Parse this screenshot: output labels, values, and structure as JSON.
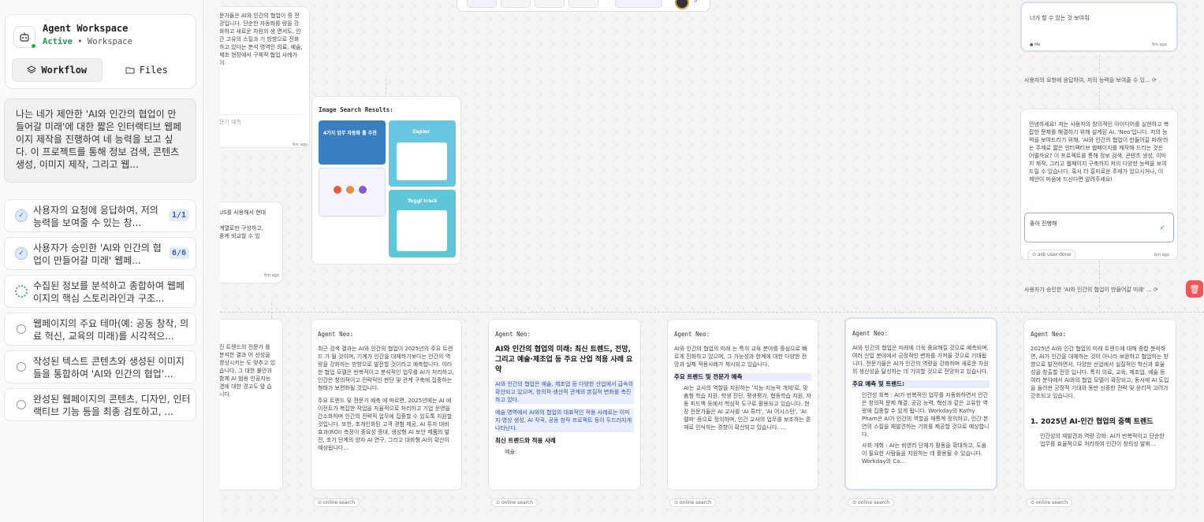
{
  "workspace": {
    "title": "Agent Workspace",
    "status": "Active",
    "separator": " • ",
    "section": "Workspace"
  },
  "tabs": [
    {
      "label": "Workflow",
      "icon": "layers-icon"
    },
    {
      "label": "Files",
      "icon": "folder-icon"
    }
  ],
  "prompt": "나는 네가 제안한 'AI와 인간의 협업이 만들어갈 미래'에 대한 짧은 인터랙티브 웹페이지 제작을 진행하여 네 능력을 보고 싶다. 이 프로젝트를 통해 정보 검색, 콘텐츠 생성, 이미지 제작, 그리고 웹...",
  "tasks": [
    {
      "text": "사용자의 요청에 응답하여, 저의 능력을 보여줄 수 있는 창...",
      "badge": "1/1",
      "state": "done"
    },
    {
      "text": "사용자가 승인한 'AI와 인간의 협업이 만들어갈 미래' 웹페...",
      "badge": "6/6",
      "state": "done"
    },
    {
      "text": "수집된 정보를 분석하고 종합하여 웹페이지의 핵심 스토리라인과 구조...",
      "state": "in-progress"
    },
    {
      "text": "웹페이지의 주요 테마(예: 공동 창작, 의료 혁신, 교육의 미래)를 시각적으...",
      "state": "todo"
    },
    {
      "text": "작성된 텍스트 콘텐츠와 생성된 이미지들을 통합하여 'AI와 인간의 협업'...",
      "state": "todo"
    },
    {
      "text": "완성된 웹페이지의 콘텐츠, 디자인, 인터랙티브 기능 등을 최종 검토하고, ...",
      "state": "todo"
    }
  ],
  "canvas": {
    "top_left_snippet": "문가들은 AI와 인간의 협업이 증 전망입니다. 단순한 자동화를 량을 강화하고 새로운 차원의 생 면서도, 인간 고유의 스킬과 기 방향으로 진화하고 있다는 분석 영역인 의료, 예술, 제조 현장에서 구체적 협업 사례가 이",
    "top_left_input": "문가 예측",
    "top_left_time": "6m ago",
    "mid_left_snippet": "US를 사용해서 현대\n\n계열로만 구성하고,\n중계 비교할 수 있",
    "mid_left_time": "6m ago",
    "image_search_label": "Image Search Results:",
    "thumb1_title": "4가지 업무 자동화 툴 추천",
    "thumb2_title": "Zapier",
    "thumb4_title": "Toggl track",
    "right_top_text": "너가 할 수 있는 것 보여줘",
    "right_top_user": "Me",
    "right_top_time": "6m ago",
    "connector1": "사용자의 요청에 응답하여, 저의 능력을 보여줄 수 있...",
    "right_agent_text": "안녕하세요! 저는 사용자의 창의적인 아이디어를 실현하고 복잡한 문제를 해결하기 위해 설계된 AI, 'Neo'입니다. 저의 능력을 보여드리기 위해, 'AI와 인간의 협업이 만들어갈 미래'라는 주제로 짧은 인터랙티브 웹페이지를 제작해 드리는 것은 어떨까요? 이 프로젝트를 통해 정보 검색, 콘텐츠 생성, 이미지 제작, 그리고 웹페이지 구축까지 저의 다양한 능력을 보여드릴 수 있습니다. 혹시 더 흥미로운 주제가 있으시거나, 이 제안이 마음에 드신다면 알려주세요!",
    "approve_text": "좋아 진행해",
    "ask_user_done": "ask user done",
    "right_mid_time": "6m ago",
    "connector2": "사용자가 승인한 'AI와 인간의 협업이 만들어갈 미래' ...",
    "online_search": "online search",
    "agent_label": "Agent Neo:",
    "col0": "진 트렌드의 전문가 를 분석한 결과 어 선성을 향상시키는 도 맞추고 있습니다. 그 대한 불안과 함께 AI 범용 인공지능 영에 대한 경고도 앞 습니다.",
    "col1": "최근 검색 결과는 AI와 인간의 협업이 2025년의 주요 트렌드 가 될 것이며, 기계가 인간을 대체하기보다는 인간의 역량을 강화하는 방향으로 발전할 것이라고 예측합니다. 이러한 협업 모델은 반복적이고 분석적인 업무를 AI가 처리하고, 인간은 창의적이고 전략적인 판단 및 관계 구축에 집중하는 형태가 보편화될 것입니다.",
    "col1b": "주요 트렌드 및 전문가 예측 에 따르면, 2025년에는 AI 에이전트가 복잡한 작업을 자율적으로 처리하고 기업 운영을 간소화하며 인간의 전략적 업무에 집중할 수 있도록 지원할 것입니다. 또한, 초개인화된 고객 경험 제공, AI 투자 대비 효과(ROI) 측정이 중요성 증대, 생성형 AI 보안 제품의 발전, 초기 단계의 양자 AI 연구, 그리고 대화형 AI의 확산이 예상됩니다...",
    "col2_title": "AI와 인간의 협업의 미래: 최신 트렌드, 전망, 그리고 예술·제조업 등 주요 산업 적용 사례 요약",
    "col2": "AI와 인간의 협업은 예술, 제조업 등 다양한 산업에서 급속히 확산되고 있으며, 창의적·생산적 관계의 본질적 변화를 촉진하고 있다.",
    "col2b": "예술 영역에서 AI와의 협업의 대표적인 적용 사례로는 이미지·영상 생성, AI 작곡, 공동 창작 프로젝트 등이 두드러지게 나타난다.",
    "col2_h": "최신 트렌드와 적용 사례",
    "col2_li": "예술:",
    "col3": "AI와 인간의 협업의 미래 는 특히 교육 분야를 중심으로 빠르게 진화하고 있으며, 그 가능성과 한계에 대한 다양한 전망과 실제 적용사례가 제시되고 있습니다.",
    "col3_h": "주요 트렌드 및 전문가 예측",
    "col3_li": "AI는 교사의 역할을 지원하는 '지능-지능적 개체'로, 맞춤형 학습 지원, 학생 진단, 평생평가, 협동학습 지원, 자동 피드백 등에서 핵심적 도구로 활용되고 있습니다. 현장 전문가들은 AI 교사를 'AI 튜터', 'AI 어시스턴', 'AI 멜퍼' 등으로 정의하며, 인간 교사의 업무를 보조하는 존재로 인식하는 경향이 확산되고 있습니다. ...",
    "col4": "AI와 인간의 협업은 미래에 더욱 중요해질 것으로 예측되며, 여러 산업 분야에서 긍정적인 변화를 가져올 것으로 기대됩니다. 전문가들은 AI가 인간의 역량을 강화하며 새로운 차원의 생산성을 달성하는 데 기여할 것으로 전망하고 있습니다.",
    "col4_h": "주요 예측 및 트렌드:",
    "col4_li1": "인간성 회복 : AI가 반복적인 업무를 자동화하면서 인간은 창의적 문제 해결, 공감 능력, 혁신과 같은 고유한 역량에 집중할 수 있게 됩니다. Workday의 Kathy Pham은 AI가 인간의 역할을 재통계 정의하고, 인간 본연의 스킬을 재발견하는 기회를 제공할 것으로 예상합니다.",
    "col4_li2": "사회 개혁 : AI는 비영리 단체가 활동을 확대하고, 도움이 필요한 사람들을 지원하는 데 활용될 수 있습니다. Workday의 Ca...",
    "col5": "2025년 AI와 인간 협업의 미래 트렌드에 대해 종합 분석하면, AI가 인간을 대체하는 것이 아니라 보완하고 협업하는 방향으로 발전하면서, 다양한 산업에서 실질적인 혁신과 효율성을 창출할 전망 입니다. 특히 의료, 교육, 제조업, 예술 등 여러 분야에서 AI와의 협업 모델이 확장되고, 동시에 AI 도입을 둘러싼 긍정적 기대와 동반 신중한 전략 및 윤리적 고려가 강조되고 있습니다.",
    "col5_h": "1. 2025년 AI-인간 협업의 중핵 트렌드",
    "col5_li": "인간성의 재발견과 역량 강화: AI가 반복적이고 단순한 업무를 효율적으로 처리하여 인간이 창의성 발휘..."
  },
  "colors": {
    "accent": "#2f6bd8",
    "active": "#1a9b4b",
    "danger": "#e55555"
  }
}
